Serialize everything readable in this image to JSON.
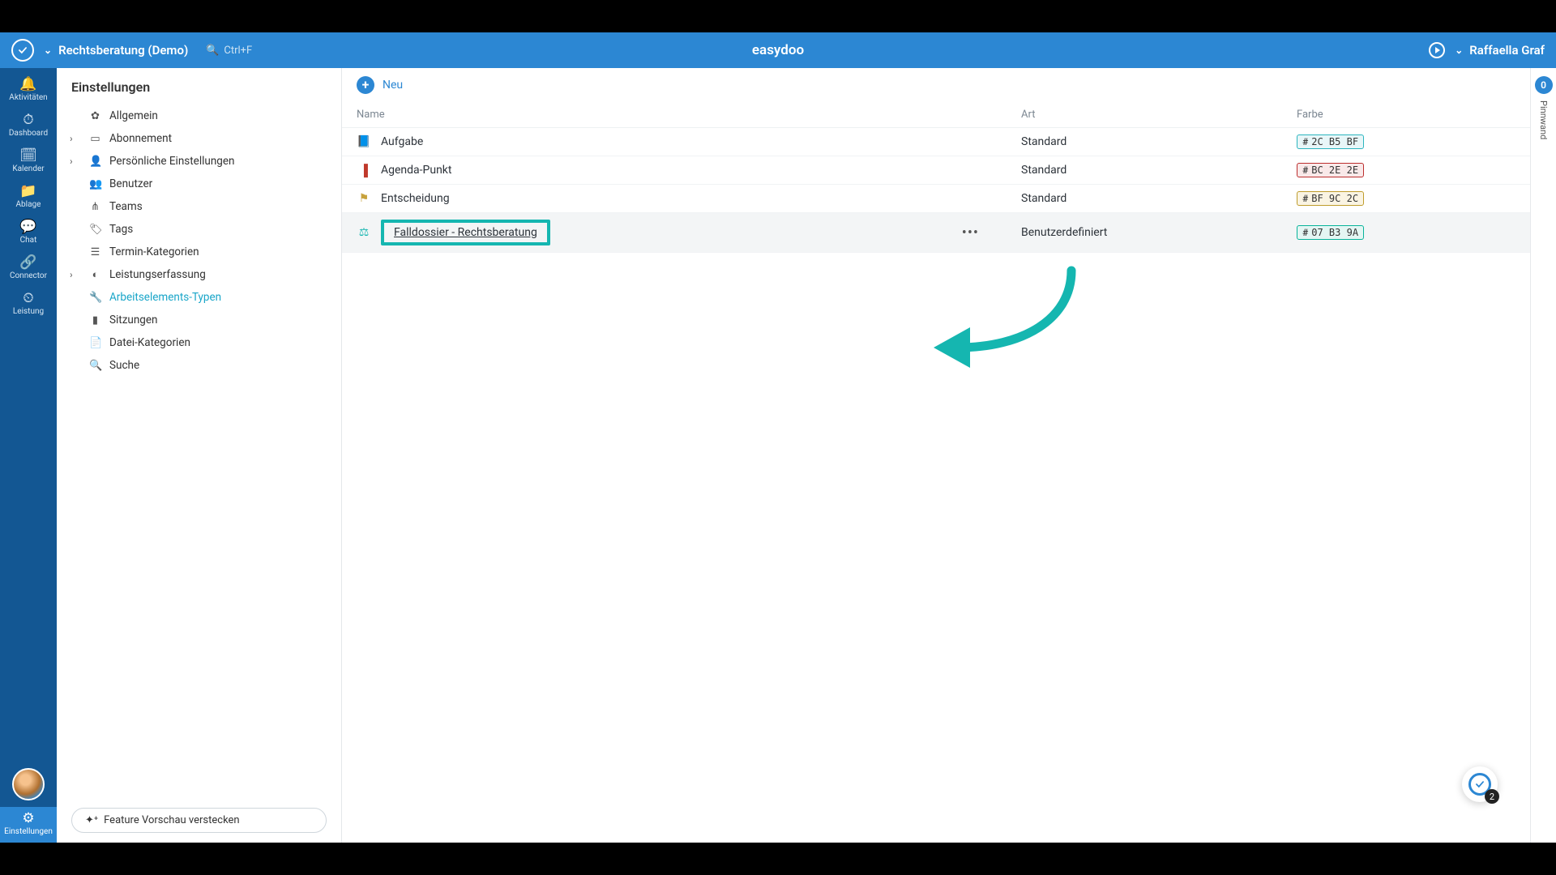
{
  "topbar": {
    "workspace": "Rechtsberatung (Demo)",
    "search_hint": "Ctrl+F",
    "brand": "easydoo",
    "user": "Raffaella Graf"
  },
  "rail": [
    {
      "icon": "🔔",
      "label": "Aktivitäten"
    },
    {
      "icon": "⏱",
      "label": "Dashboard"
    },
    {
      "icon": "🗓",
      "label": "Kalender"
    },
    {
      "icon": "📁",
      "label": "Ablage"
    },
    {
      "icon": "💬",
      "label": "Chat"
    },
    {
      "icon": "🔗",
      "label": "Connector"
    },
    {
      "icon": "⏲",
      "label": "Leistung"
    }
  ],
  "rail_bottom": {
    "icon": "⚙",
    "label": "Einstellungen"
  },
  "sidepanel": {
    "title": "Einstellungen",
    "items": [
      {
        "icon": "✿",
        "label": "Allgemein"
      },
      {
        "icon": "▭",
        "label": "Abonnement",
        "expandable": true
      },
      {
        "icon": "👤",
        "label": "Persönliche Einstellungen",
        "expandable": true
      },
      {
        "icon": "👥",
        "label": "Benutzer"
      },
      {
        "icon": "⋔",
        "label": "Teams"
      },
      {
        "icon": "🏷",
        "label": "Tags"
      },
      {
        "icon": "☰",
        "label": "Termin-Kategorien"
      },
      {
        "icon": "◐",
        "label": "Leistungserfassung",
        "expandable": true
      },
      {
        "icon": "🔧",
        "label": "Arbeitselements-Typen",
        "selected": true
      },
      {
        "icon": "▮",
        "label": "Sitzungen"
      },
      {
        "icon": "📄",
        "label": "Datei-Kategorien"
      },
      {
        "icon": "🔍",
        "label": "Suche"
      }
    ],
    "feature_button": "Feature Vorschau verstecken"
  },
  "main": {
    "new_label": "Neu",
    "columns": {
      "name": "Name",
      "art": "Art",
      "farbe": "Farbe"
    },
    "rows": [
      {
        "icon": "📘",
        "icon_color": "#1aa6c9",
        "name": "Aufgabe",
        "art": "Standard",
        "color_hex": "2C B5 BF",
        "badge_bg": "#e8f6f8",
        "badge_border": "#2cb5bf"
      },
      {
        "icon": "▐",
        "icon_color": "#c0392b",
        "name": "Agenda-Punkt",
        "art": "Standard",
        "color_hex": "BC 2E 2E",
        "badge_bg": "#f9e9e9",
        "badge_border": "#bc2e2e"
      },
      {
        "icon": "⚑",
        "icon_color": "#c7a23c",
        "name": "Entscheidung",
        "art": "Standard",
        "color_hex": "BF 9C 2C",
        "badge_bg": "#faf4e3",
        "badge_border": "#bf9c2c"
      },
      {
        "icon": "⚖",
        "icon_color": "#15b6b0",
        "name": "Falldossier - Rechtsberatung",
        "art": "Benutzerdefiniert",
        "color_hex": "07 B3 9A",
        "badge_bg": "#e4f6f3",
        "badge_border": "#07b39a",
        "hovered": true,
        "highlighted": true
      }
    ]
  },
  "pinbar": {
    "count": "0",
    "label": "Pinnwand"
  },
  "float": {
    "count": "2"
  }
}
